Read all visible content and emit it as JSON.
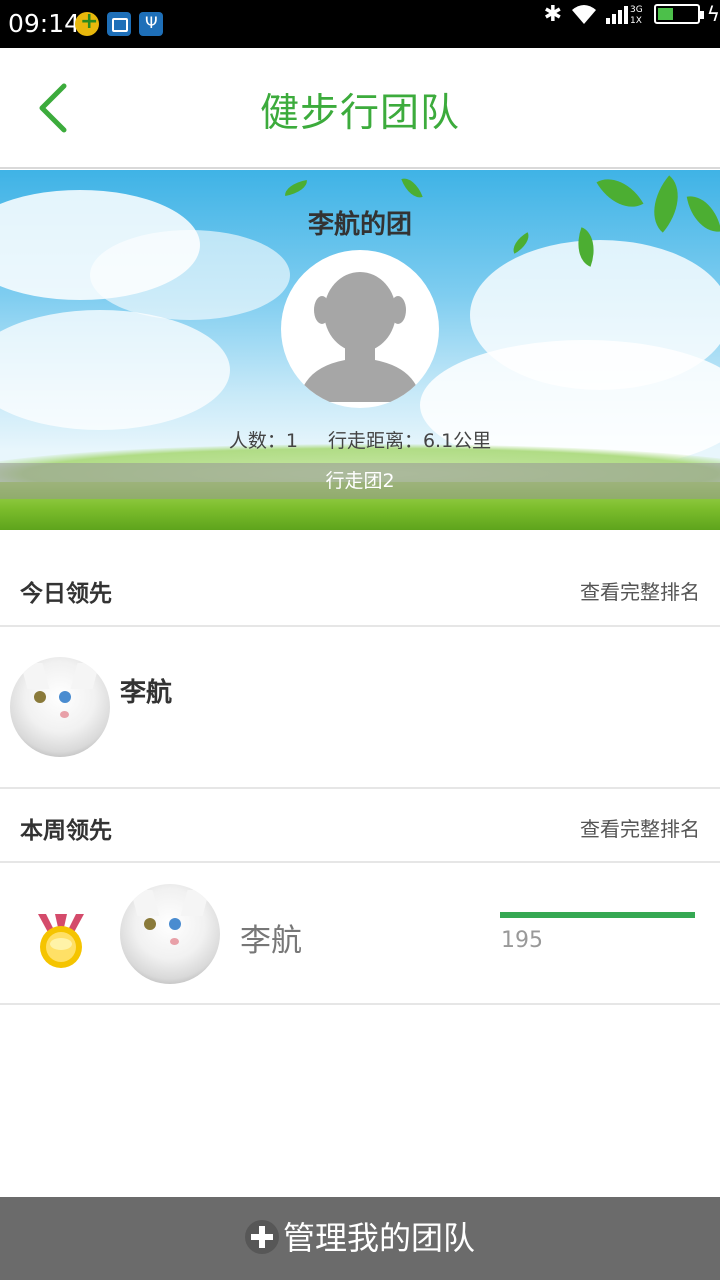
{
  "status_bar": {
    "time": "09:14",
    "network_label": "3G\n1X"
  },
  "header": {
    "title": "健步行团队",
    "back_icon": "chevron-left-icon"
  },
  "banner": {
    "team_owner_title": "李航的团",
    "members_text": "人数：1",
    "distance_text": "行走距离：6.1公里",
    "team_name": "行走团2"
  },
  "today": {
    "title": "今日领先",
    "link": "查看完整排名",
    "leader": {
      "name": "李航"
    }
  },
  "week": {
    "title": "本周领先",
    "link": "查看完整排名",
    "leader": {
      "name": "李航",
      "steps": "195",
      "bar_fraction": 1.0,
      "medal": "gold-medal-icon"
    }
  },
  "bottom": {
    "manage_label": "管理我的团队"
  },
  "colors": {
    "accent_green": "#3cab3c",
    "bar_green": "#35a853",
    "bottom_bar": "#6b6b6b"
  }
}
